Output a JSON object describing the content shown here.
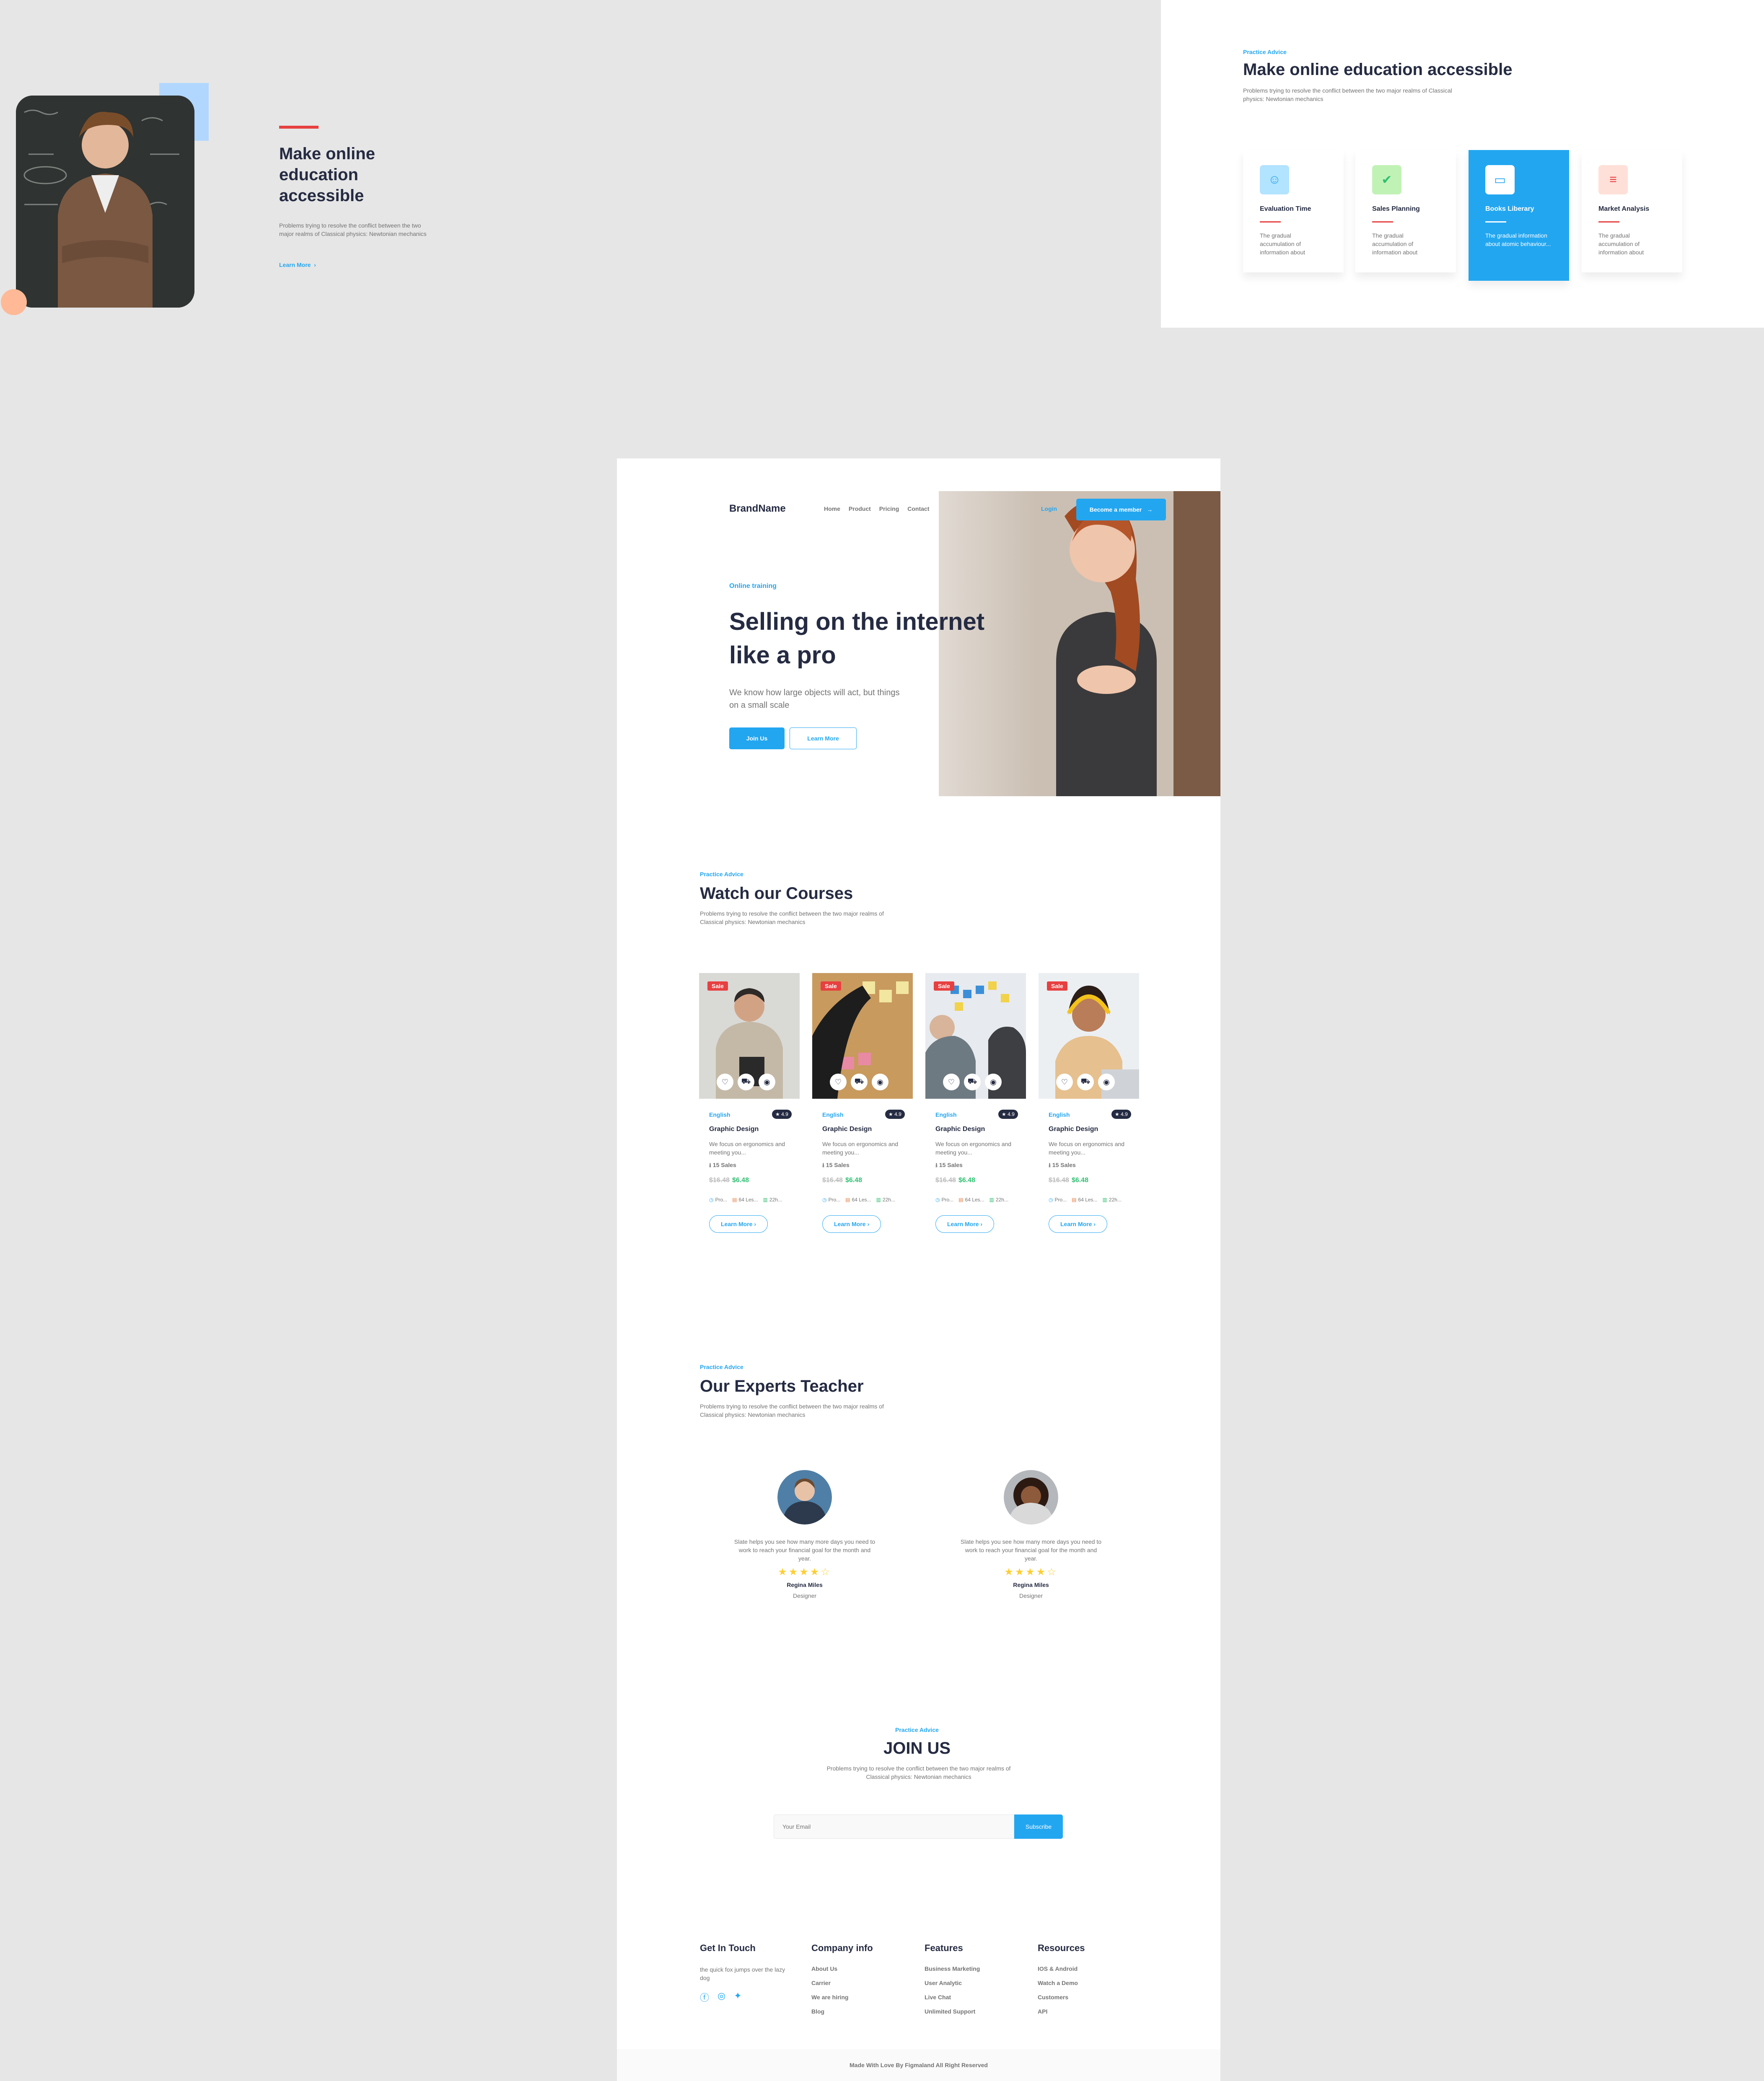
{
  "showcase_left": {
    "title": "Make online education accessible",
    "desc": "Problems trying to resolve the conflict between the two major realms of Classical physics: Newtonian mechanics",
    "link": "Learn More"
  },
  "showcase_right": {
    "kicker": "Practice Advice",
    "title": "Make online education accessible",
    "desc": "Problems trying to resolve the conflict between the two major realms of Classical physics: Newtonian mechanics",
    "cards": [
      {
        "title": "Evaluation Time",
        "desc": "The gradual accumulation of information about",
        "icon": "smile-icon",
        "color": "#b2e3ff"
      },
      {
        "title": "Sales Planning",
        "desc": "The gradual accumulation of information about",
        "icon": "check-icon",
        "color": "#c1f2b5"
      },
      {
        "title": "Books Liberary",
        "desc": "The gradual information about atomic behaviour...",
        "icon": "card-icon",
        "color": "#ffffff"
      },
      {
        "title": "Market Analysis",
        "desc": "The gradual accumulation of information about",
        "icon": "sliders-icon",
        "color": "#ffe0d9"
      }
    ]
  },
  "nav": {
    "brand": "BrandName",
    "links": [
      "Home",
      "Product",
      "Pricing",
      "Contact"
    ],
    "login": "Login",
    "cta": "Become a member"
  },
  "hero": {
    "kicker": "Online training",
    "title": "Selling on the internet like a pro",
    "desc": "We know how large objects will act, but things on a small scale",
    "primary": "Join Us",
    "secondary": "Learn More"
  },
  "courses_section": {
    "kicker": "Practice Advice",
    "title": "Watch our Courses",
    "desc": "Problems trying to resolve the conflict between the two major realms of Classical physics: Newtonian mechanics"
  },
  "courses": [
    {
      "sale": "Sale",
      "lang": "English",
      "rating": "4.9",
      "title": "Graphic Design",
      "desc": "We focus on ergonomics and meeting you...",
      "sales": "15 Sales",
      "old_price": "$16.48",
      "new_price": "$6.48",
      "meta1": "Pro...",
      "meta2": "64 Les...",
      "meta3": "22h...",
      "link": "Learn More"
    },
    {
      "sale": "Sale",
      "lang": "English",
      "rating": "4.9",
      "title": "Graphic Design",
      "desc": "We focus on ergonomics and meeting you...",
      "sales": "15 Sales",
      "old_price": "$16.48",
      "new_price": "$6.48",
      "meta1": "Pro...",
      "meta2": "64 Les...",
      "meta3": "22h...",
      "link": "Learn More"
    },
    {
      "sale": "Sale",
      "lang": "English",
      "rating": "4.9",
      "title": "Graphic Design",
      "desc": "We focus on ergonomics and meeting you...",
      "sales": "15 Sales",
      "old_price": "$16.48",
      "new_price": "$6.48",
      "meta1": "Pro...",
      "meta2": "64 Les...",
      "meta3": "22h...",
      "link": "Learn More"
    },
    {
      "sale": "Sale",
      "lang": "English",
      "rating": "4.9",
      "title": "Graphic Design",
      "desc": "We focus on ergonomics and meeting you...",
      "sales": "15 Sales",
      "old_price": "$16.48",
      "new_price": "$6.48",
      "meta1": "Pro...",
      "meta2": "64 Les...",
      "meta3": "22h...",
      "link": "Learn More"
    }
  ],
  "teachers_section": {
    "kicker": "Practice Advice",
    "title": "Our Experts Teacher",
    "desc": "Problems trying to resolve the conflict between the two major realms of Classical physics: Newtonian mechanics"
  },
  "teachers": [
    {
      "quote": "Slate helps you see how many more days you need to work to reach your financial goal for the month and year.",
      "stars": "★★★★☆",
      "rating": 4,
      "name": "Regina Miles",
      "role": "Designer"
    },
    {
      "quote": "Slate helps you see how many more days you need to work to reach your financial goal for the month and year.",
      "stars": "★★★★☆",
      "rating": 4,
      "name": "Regina Miles",
      "role": "Designer"
    }
  ],
  "join": {
    "kicker": "Practice Advice",
    "title": "JOIN US",
    "desc": "Problems trying to resolve the conflict between the two major realms of Classical physics: Newtonian mechanics",
    "placeholder": "Your Email",
    "button": "Subscribe"
  },
  "footer": {
    "get_in_touch": {
      "title": "Get In Touch",
      "text": "the quick fox jumps over the lazy dog"
    },
    "company": {
      "title": "Company info",
      "links": [
        "About Us",
        "Carrier",
        "We are hiring",
        "Blog"
      ]
    },
    "features": {
      "title": "Features",
      "links": [
        "Business Marketing",
        "User Analytic",
        "Live Chat",
        "Unlimited Support"
      ]
    },
    "resources": {
      "title": "Resources",
      "links": [
        "IOS & Android",
        "Watch a Demo",
        "Customers",
        "API"
      ]
    },
    "copyright": "Made With Love By Figmaland All Right Reserved"
  }
}
